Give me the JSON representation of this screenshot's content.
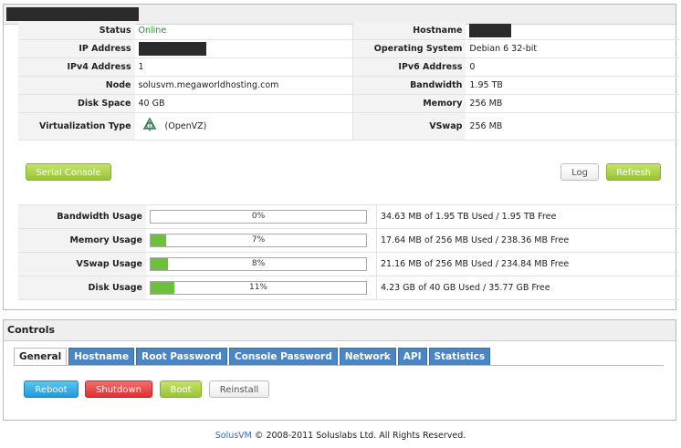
{
  "server": {
    "info_left": [
      {
        "label": "Status",
        "value": "Online",
        "color": "#1c9b1c"
      },
      {
        "label": "IP Address",
        "value": ""
      },
      {
        "label": "IPv4 Address",
        "value": "1"
      },
      {
        "label": "Node",
        "value": "solusvm.megaworldhosting.com"
      },
      {
        "label": "Disk Space",
        "value": "40 GB"
      },
      {
        "label": "Virtualization Type",
        "value": "(OpenVZ)",
        "icon": "openvz-icon"
      }
    ],
    "info_right": [
      {
        "label": "Hostname",
        "value": ""
      },
      {
        "label": "Operating System",
        "value": "Debian 6 32-bit"
      },
      {
        "label": "IPv6 Address",
        "value": "0"
      },
      {
        "label": "Bandwidth",
        "value": "1.95 TB"
      },
      {
        "label": "Memory",
        "value": "256 MB"
      },
      {
        "label": "VSwap",
        "value": "256 MB"
      }
    ],
    "buttons": {
      "serial_console": "Serial Console",
      "log": "Log",
      "refresh": "Refresh"
    },
    "usage": [
      {
        "label": "Bandwidth Usage",
        "percent": 0,
        "percent_text": "0%",
        "detail": "34.63 MB of 1.95 TB Used / 1.95 TB Free"
      },
      {
        "label": "Memory Usage",
        "percent": 7,
        "percent_text": "7%",
        "detail": "17.64 MB of 256 MB Used / 238.36 MB Free"
      },
      {
        "label": "VSwap Usage",
        "percent": 8,
        "percent_text": "8%",
        "detail": "21.16 MB of 256 MB Used / 234.84 MB Free"
      },
      {
        "label": "Disk Usage",
        "percent": 11,
        "percent_text": "11%",
        "detail": "4.23 GB of 40 GB Used / 35.77 GB Free"
      }
    ]
  },
  "controls": {
    "title": "Controls",
    "tabs": [
      "General",
      "Hostname",
      "Root Password",
      "Console Password",
      "Network",
      "API",
      "Statistics"
    ],
    "active_tab": "General",
    "actions": {
      "reboot": "Reboot",
      "shutdown": "Shutdown",
      "boot": "Boot",
      "reinstall": "Reinstall"
    }
  },
  "footer": {
    "brand": "SolusVM",
    "text": "© 2008-2011 Soluslabs Ltd. All Rights Reserved."
  },
  "colors": {
    "online": "#1c9b1c",
    "tab_bg": "#4a86c6",
    "progress_fill": "#6bc13a"
  }
}
